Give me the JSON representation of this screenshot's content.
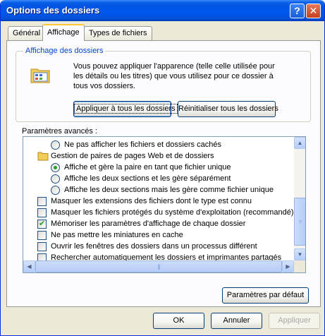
{
  "window": {
    "title": "Options des dossiers"
  },
  "tabs": [
    "Général",
    "Affichage",
    "Types de fichiers"
  ],
  "folder_view": {
    "label": "Affichage des dossiers",
    "description": "Vous pouvez appliquer l'apparence (telle celle utilisée pour les détails ou les titres) que vous utilisez pour ce dossier à tous vos dossiers.",
    "apply_all": "Appliquer à tous les dossiers",
    "reset_all": "Réinitialiser tous les dossiers"
  },
  "advanced": {
    "label": "Paramètres avancés :",
    "items": [
      {
        "text": "Ne pas afficher les fichiers et dossiers cachés",
        "kind": "radio",
        "checked": false,
        "indent": 1
      },
      {
        "text": "Gestion de paires de pages Web et de dossiers",
        "kind": "folder",
        "checked": false,
        "indent": 0
      },
      {
        "text": "Affiche et gère la paire en tant que fichier unique",
        "kind": "radio",
        "checked": true,
        "indent": 1
      },
      {
        "text": "Affiche les deux sections et les gère séparément",
        "kind": "radio",
        "checked": false,
        "indent": 1
      },
      {
        "text": "Affiche les deux sections mais les gère comme fichier unique",
        "kind": "radio",
        "checked": false,
        "indent": 1
      },
      {
        "text": "Masquer les extensions des fichiers dont le type est connu",
        "kind": "checkbox",
        "checked": false,
        "indent": 0
      },
      {
        "text": "Masquer les fichiers protégés du système d'exploitation (recommandé)",
        "kind": "checkbox",
        "checked": false,
        "indent": 0
      },
      {
        "text": "Mémoriser les paramètres d'affichage de chaque dossier",
        "kind": "checkbox",
        "checked": true,
        "indent": 0
      },
      {
        "text": "Ne pas mettre les miniatures en cache",
        "kind": "checkbox",
        "checked": false,
        "indent": 0
      },
      {
        "text": "Ouvrir les fenêtres des dossiers dans un processus différent",
        "kind": "checkbox",
        "checked": false,
        "indent": 0
      },
      {
        "text": "Rechercher automatiquement les dossiers et imprimantes partagés",
        "kind": "checkbox",
        "checked": false,
        "indent": 0
      }
    ]
  },
  "defaults_button": "Paramètres par défaut",
  "buttons": {
    "ok": "OK",
    "cancel": "Annuler",
    "apply": "Appliquer"
  },
  "icons": {
    "help": "help-icon",
    "close": "close-icon",
    "scroll_up": "chevron-up-icon",
    "scroll_down": "chevron-down-icon",
    "scroll_left": "chevron-left-icon",
    "scroll_right": "chevron-right-icon",
    "folder": "folder-icon",
    "folder_view": "folder-view-icon"
  },
  "colors": {
    "titlebar": "#0054e3",
    "dialog": "#ece9d8",
    "group_label": "#0046d5",
    "check": "#21a121",
    "tab_highlight": "#ffc83c"
  }
}
